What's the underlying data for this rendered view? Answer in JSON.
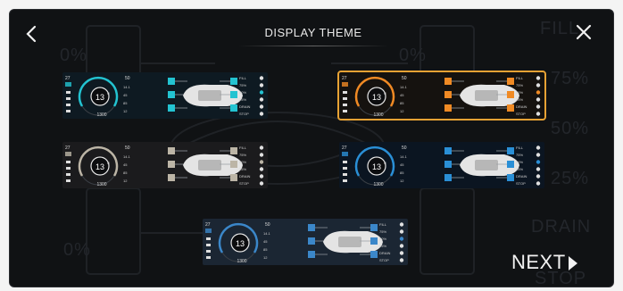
{
  "header": {
    "title": "DISPLAY THEME"
  },
  "background": {
    "pct_left_top": "0%",
    "pct_left_bottom": "0%",
    "pct_right_top": "0%",
    "fill": "FILL",
    "p75": "75%",
    "p50": "50%",
    "p25": "25%",
    "drain": "DRAIN",
    "stop": "STOP"
  },
  "footer": {
    "next_label": "NEXT"
  },
  "themes": [
    {
      "name": "teal",
      "accent": "#23c3d1",
      "bg": "#0e1a22",
      "selected": false
    },
    {
      "name": "orange",
      "accent": "#f08a24",
      "bg": "#15120f",
      "selected": true
    },
    {
      "name": "gray",
      "accent": "#bcb5a6",
      "bg": "#1b1b1d",
      "selected": false
    },
    {
      "name": "blue-dark",
      "accent": "#2a8fd6",
      "bg": "#0b1521",
      "selected": false
    },
    {
      "name": "steel-blue",
      "accent": "#3b87c9",
      "bg": "#1b2633",
      "selected": false
    }
  ],
  "thumbnail": {
    "speed": "13",
    "speed_unit": "R",
    "odometer": "1300",
    "top_left": "27",
    "top_mid": "50",
    "labels_right": [
      "FILL",
      "75%",
      "50%",
      "25%",
      "DRAIN",
      "STOP"
    ],
    "side_values": [
      "14.1",
      "45",
      "85",
      "12"
    ]
  }
}
